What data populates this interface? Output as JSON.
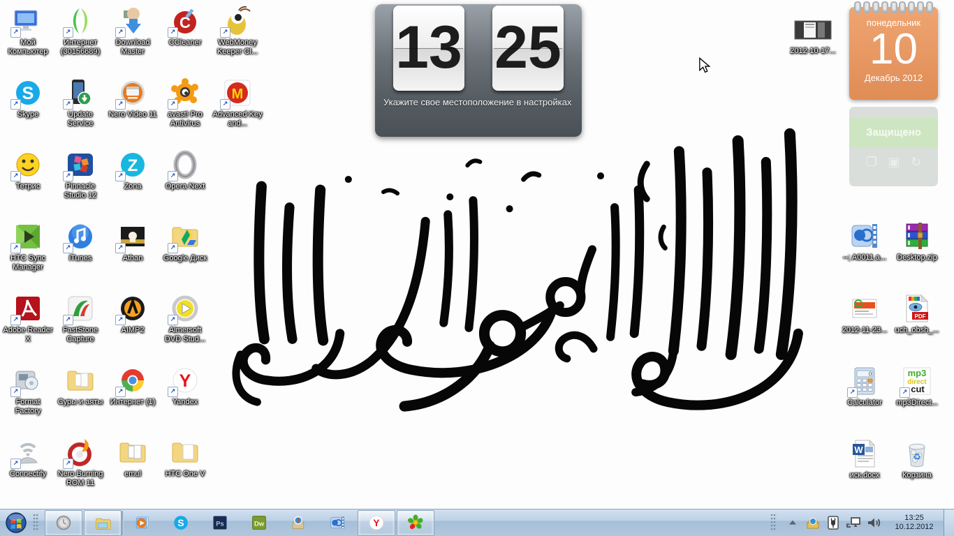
{
  "wallpaper": {
    "description": "Black shahada calligraphy (thuluth script) on white background",
    "ink_color": "#070707",
    "background_color": "#fdfdfd"
  },
  "widgets": {
    "clock": {
      "hours": "13",
      "minutes": "25",
      "note": "Укажите свое местоположение в настройках"
    },
    "calendar": {
      "weekday": "понедельник",
      "day": "10",
      "month_year": "Декабрь 2012",
      "accent": "#e79465"
    },
    "security": {
      "status": "Защищено",
      "band_color": "#cde5c1",
      "buttons": [
        "open-window",
        "stop",
        "refresh"
      ]
    }
  },
  "desktop": {
    "icons": [
      {
        "label": "Мой Компьютер"
      },
      {
        "label": "Интернет (30156689)"
      },
      {
        "label": "Download Master"
      },
      {
        "label": "CCleaner"
      },
      {
        "label": "WebMoney Keeper Cl..."
      },
      {
        "label": "Skype"
      },
      {
        "label": "Update Service"
      },
      {
        "label": "Nero Video 11"
      },
      {
        "label": "avast! Pro Antivirus"
      },
      {
        "label": "Advanced Key and..."
      },
      {
        "label": "Тетрис"
      },
      {
        "label": "Pinnacle Studio 12"
      },
      {
        "label": "Zona"
      },
      {
        "label": "Opera Next"
      },
      {
        "label": "HTC Sync Manager"
      },
      {
        "label": "iTunes"
      },
      {
        "label": "Athan"
      },
      {
        "label": "Google Диск"
      },
      {
        "label": "Adobe Reader X"
      },
      {
        "label": "FastStone Capture"
      },
      {
        "label": "AIMP2"
      },
      {
        "label": "Aimersoft DVD Stud..."
      },
      {
        "label": "Format Factory"
      },
      {
        "label": "Суры и аяты"
      },
      {
        "label": "Интернет (1)"
      },
      {
        "label": "Yandex"
      },
      {
        "label": "Connectify"
      },
      {
        "label": "Nero Burning ROM 11"
      },
      {
        "label": "emul"
      },
      {
        "label": "HTC One V"
      }
    ],
    "right_icons": [
      {
        "label": "--; A0011.a..."
      },
      {
        "label": "Desktop.zip"
      },
      {
        "label": "2012-11-23..."
      },
      {
        "label": "uch_obsh_..."
      },
      {
        "label": "Calculator"
      },
      {
        "label": "mp3Direct..."
      },
      {
        "label": "иск.docx"
      },
      {
        "label": "Корзина"
      }
    ],
    "top_right_icon": {
      "label": "2012-10-17..."
    }
  },
  "icon_glyphs": {
    "ccleaner": "C",
    "skype": "S",
    "zona": "Z",
    "yandex": "Y",
    "advanced_m": "M",
    "ps": "Ps",
    "dw": "Dw",
    "word": "W",
    "pdf": "PDF",
    "mp3": "mp3",
    "direct": "direct",
    "cut": "cut",
    "calc_display": "0"
  },
  "taskbar": {
    "buttons": [
      "start",
      "clock-app",
      "windows-explorer",
      "windows-media-player",
      "skype",
      "photoshop",
      "dreamweaver",
      "daemon-tools",
      "media-player-classic",
      "yandex-browser",
      "icq"
    ],
    "open_buttons": [
      "clock-app",
      "windows-explorer",
      "yandex-browser",
      "icq"
    ],
    "tray_icons": [
      "hidden-icons-arrow",
      "daemon-tools-tray",
      "safely-remove-hardware",
      "network",
      "volume"
    ],
    "clock": {
      "time": "13:25",
      "date": "10.12.2012"
    }
  }
}
